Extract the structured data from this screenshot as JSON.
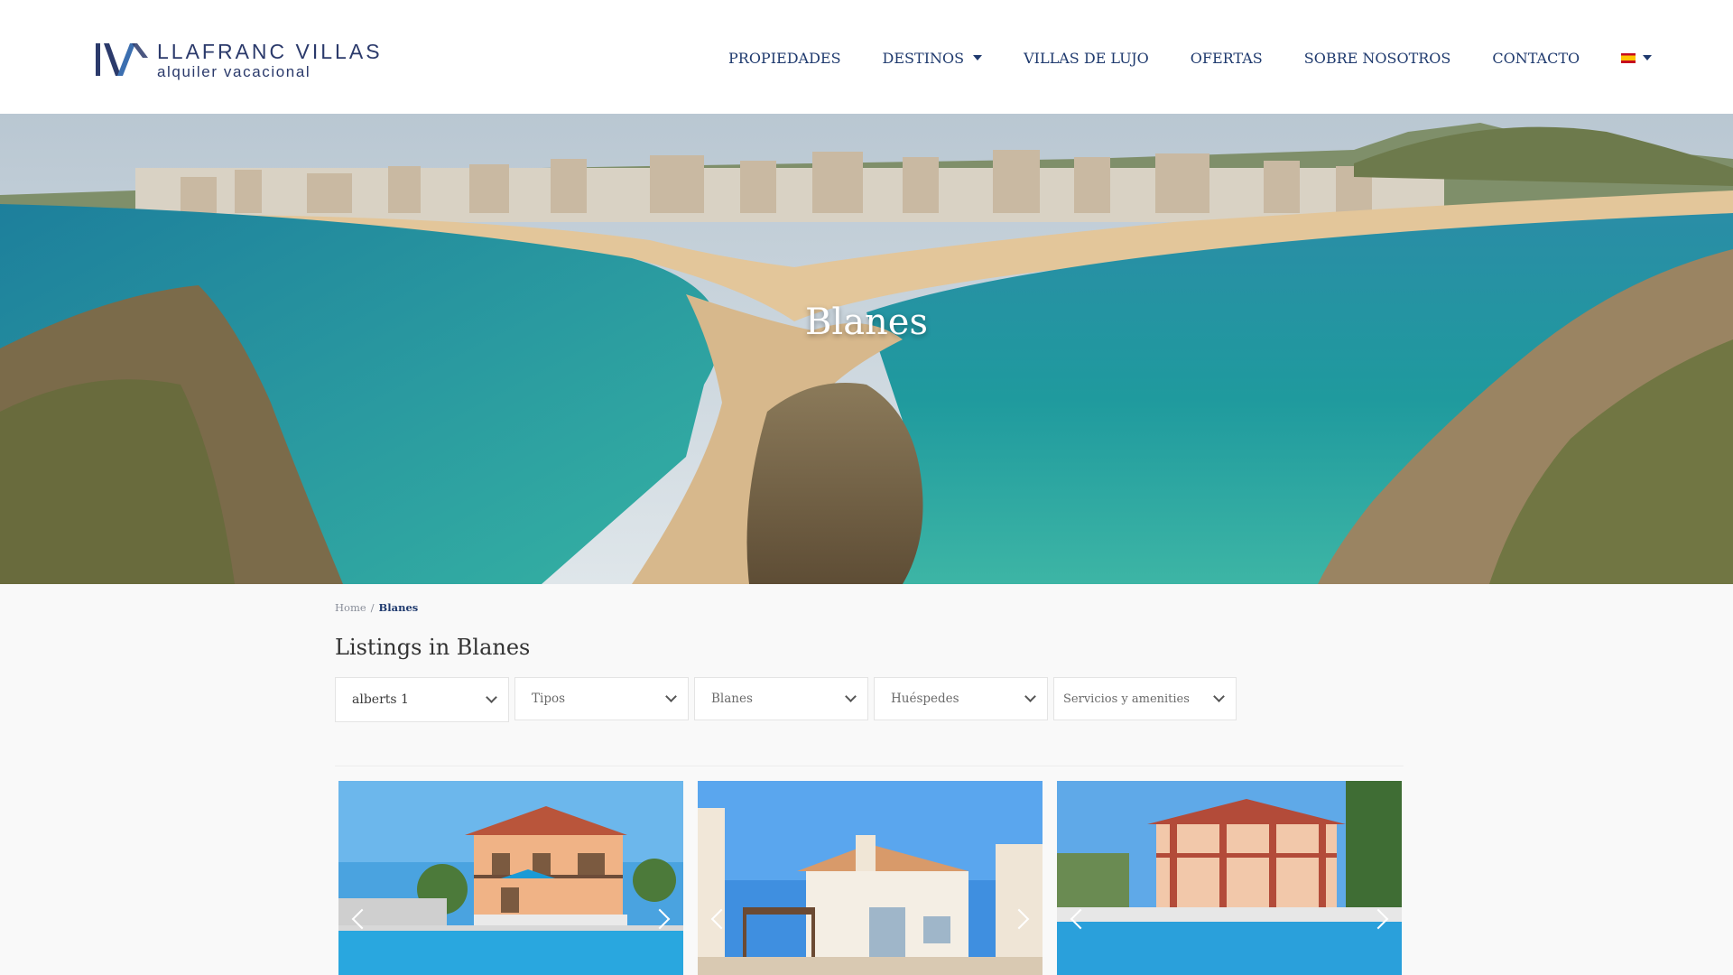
{
  "header": {
    "logo": {
      "name": "LLAFRANC VILLAS",
      "subtitle": "alquiler vacacional"
    },
    "nav": [
      {
        "label": "PROPIEDADES",
        "has_dropdown": false
      },
      {
        "label": "DESTINOS",
        "has_dropdown": true
      },
      {
        "label": "VILLAS DE LUJO",
        "has_dropdown": false
      },
      {
        "label": "OFERTAS",
        "has_dropdown": false
      },
      {
        "label": "SOBRE NOSOTROS",
        "has_dropdown": false
      },
      {
        "label": "CONTACTO",
        "has_dropdown": false
      }
    ],
    "language": {
      "icon": "spain-flag-icon",
      "has_dropdown": true
    }
  },
  "hero": {
    "title": "Blanes"
  },
  "breadcrumb": {
    "home": "Home",
    "separator": "/",
    "current": "Blanes"
  },
  "listings": {
    "title": "Listings in Blanes"
  },
  "filters": [
    {
      "value": "alberts 1"
    },
    {
      "value": "Tipos"
    },
    {
      "value": "Blanes"
    },
    {
      "value": "Huéspedes"
    },
    {
      "value": "Servicios y amenities"
    }
  ],
  "cards": [
    {
      "image": "villa-peach-two-storey-pool-photo"
    },
    {
      "image": "villa-white-bungalow-pergola-photo"
    },
    {
      "image": "villa-red-columns-pool-photo"
    }
  ],
  "colors": {
    "nav": "#1f3a6e",
    "logo": "#2b3a6b",
    "background": "#f9f9f9"
  }
}
